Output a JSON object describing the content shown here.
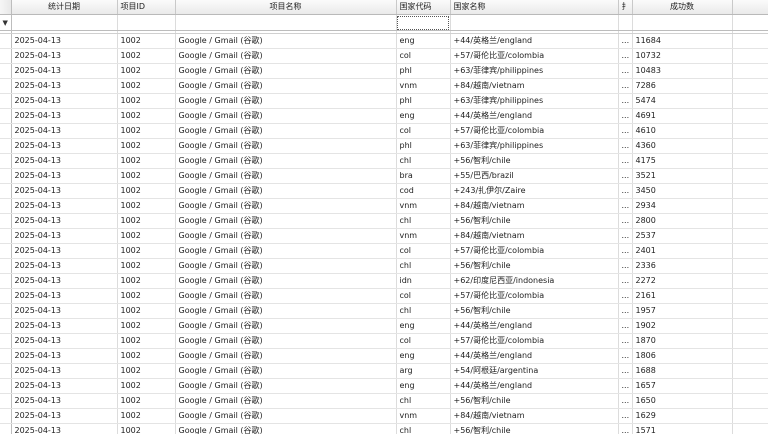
{
  "columns": [
    {
      "key": "date",
      "label": "统计日期"
    },
    {
      "key": "pid",
      "label": "项目ID"
    },
    {
      "key": "pname",
      "label": "项目名称"
    },
    {
      "key": "code",
      "label": "国家代码"
    },
    {
      "key": "country",
      "label": "国家名称"
    },
    {
      "key": "extra",
      "label": "扌"
    },
    {
      "key": "count",
      "label": "成功数"
    }
  ],
  "filter_icon": "filter-row-icon",
  "rows": [
    {
      "date": "2025-04-13",
      "pid": "1002",
      "pname": "Google / Gmail (谷歌)",
      "code": "eng",
      "country": "+44/英格兰/england",
      "extra": "...",
      "count": "11684"
    },
    {
      "date": "2025-04-13",
      "pid": "1002",
      "pname": "Google / Gmail (谷歌)",
      "code": "col",
      "country": "+57/哥伦比亚/colombia",
      "extra": "...",
      "count": "10732"
    },
    {
      "date": "2025-04-13",
      "pid": "1002",
      "pname": "Google / Gmail (谷歌)",
      "code": "phl",
      "country": "+63/菲律宾/philippines",
      "extra": "...",
      "count": "10483"
    },
    {
      "date": "2025-04-13",
      "pid": "1002",
      "pname": "Google / Gmail (谷歌)",
      "code": "vnm",
      "country": "+84/越南/vietnam",
      "extra": "...",
      "count": "7286"
    },
    {
      "date": "2025-04-13",
      "pid": "1002",
      "pname": "Google / Gmail (谷歌)",
      "code": "phl",
      "country": "+63/菲律宾/philippines",
      "extra": "...",
      "count": "5474"
    },
    {
      "date": "2025-04-13",
      "pid": "1002",
      "pname": "Google / Gmail (谷歌)",
      "code": "eng",
      "country": "+44/英格兰/england",
      "extra": "...",
      "count": "4691"
    },
    {
      "date": "2025-04-13",
      "pid": "1002",
      "pname": "Google / Gmail (谷歌)",
      "code": "col",
      "country": "+57/哥伦比亚/colombia",
      "extra": "...",
      "count": "4610"
    },
    {
      "date": "2025-04-13",
      "pid": "1002",
      "pname": "Google / Gmail (谷歌)",
      "code": "phl",
      "country": "+63/菲律宾/philippines",
      "extra": "...",
      "count": "4360"
    },
    {
      "date": "2025-04-13",
      "pid": "1002",
      "pname": "Google / Gmail (谷歌)",
      "code": "chl",
      "country": "+56/智利/chile",
      "extra": "...",
      "count": "4175"
    },
    {
      "date": "2025-04-13",
      "pid": "1002",
      "pname": "Google / Gmail (谷歌)",
      "code": "bra",
      "country": "+55/巴西/brazil",
      "extra": "...",
      "count": "3521"
    },
    {
      "date": "2025-04-13",
      "pid": "1002",
      "pname": "Google / Gmail (谷歌)",
      "code": "cod",
      "country": "+243/扎伊尔/Zaire",
      "extra": "...",
      "count": "3450"
    },
    {
      "date": "2025-04-13",
      "pid": "1002",
      "pname": "Google / Gmail (谷歌)",
      "code": "vnm",
      "country": "+84/越南/vietnam",
      "extra": "...",
      "count": "2934"
    },
    {
      "date": "2025-04-13",
      "pid": "1002",
      "pname": "Google / Gmail (谷歌)",
      "code": "chl",
      "country": "+56/智利/chile",
      "extra": "...",
      "count": "2800"
    },
    {
      "date": "2025-04-13",
      "pid": "1002",
      "pname": "Google / Gmail (谷歌)",
      "code": "vnm",
      "country": "+84/越南/vietnam",
      "extra": "...",
      "count": "2537"
    },
    {
      "date": "2025-04-13",
      "pid": "1002",
      "pname": "Google / Gmail (谷歌)",
      "code": "col",
      "country": "+57/哥伦比亚/colombia",
      "extra": "...",
      "count": "2401"
    },
    {
      "date": "2025-04-13",
      "pid": "1002",
      "pname": "Google / Gmail (谷歌)",
      "code": "chl",
      "country": "+56/智利/chile",
      "extra": "...",
      "count": "2336"
    },
    {
      "date": "2025-04-13",
      "pid": "1002",
      "pname": "Google / Gmail (谷歌)",
      "code": "idn",
      "country": "+62/印度尼西亚/indonesia",
      "extra": "...",
      "count": "2272"
    },
    {
      "date": "2025-04-13",
      "pid": "1002",
      "pname": "Google / Gmail (谷歌)",
      "code": "col",
      "country": "+57/哥伦比亚/colombia",
      "extra": "...",
      "count": "2161"
    },
    {
      "date": "2025-04-13",
      "pid": "1002",
      "pname": "Google / Gmail (谷歌)",
      "code": "chl",
      "country": "+56/智利/chile",
      "extra": "...",
      "count": "1957"
    },
    {
      "date": "2025-04-13",
      "pid": "1002",
      "pname": "Google / Gmail (谷歌)",
      "code": "eng",
      "country": "+44/英格兰/england",
      "extra": "...",
      "count": "1902"
    },
    {
      "date": "2025-04-13",
      "pid": "1002",
      "pname": "Google / Gmail (谷歌)",
      "code": "col",
      "country": "+57/哥伦比亚/colombia",
      "extra": "...",
      "count": "1870"
    },
    {
      "date": "2025-04-13",
      "pid": "1002",
      "pname": "Google / Gmail (谷歌)",
      "code": "eng",
      "country": "+44/英格兰/england",
      "extra": "...",
      "count": "1806"
    },
    {
      "date": "2025-04-13",
      "pid": "1002",
      "pname": "Google / Gmail (谷歌)",
      "code": "arg",
      "country": "+54/阿根廷/argentina",
      "extra": "...",
      "count": "1688"
    },
    {
      "date": "2025-04-13",
      "pid": "1002",
      "pname": "Google / Gmail (谷歌)",
      "code": "eng",
      "country": "+44/英格兰/england",
      "extra": "...",
      "count": "1657"
    },
    {
      "date": "2025-04-13",
      "pid": "1002",
      "pname": "Google / Gmail (谷歌)",
      "code": "chl",
      "country": "+56/智利/chile",
      "extra": "...",
      "count": "1650"
    },
    {
      "date": "2025-04-13",
      "pid": "1002",
      "pname": "Google / Gmail (谷歌)",
      "code": "vnm",
      "country": "+84/越南/vietnam",
      "extra": "...",
      "count": "1629"
    },
    {
      "date": "2025-04-13",
      "pid": "1002",
      "pname": "Google / Gmail (谷歌)",
      "code": "chl",
      "country": "+56/智利/chile",
      "extra": "...",
      "count": "1571"
    }
  ]
}
